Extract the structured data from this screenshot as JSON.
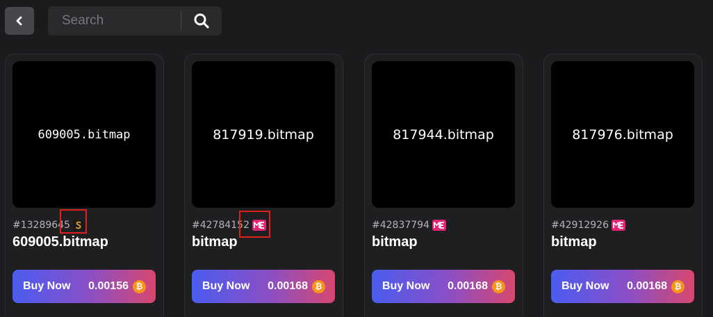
{
  "search": {
    "placeholder": "Search"
  },
  "icons": {
    "back": "chevron-left-icon",
    "search": "magnifier-icon",
    "currency": "bitcoin-icon",
    "marketplaces": [
      "s-marketplace-icon",
      "me-marketplace-icon"
    ]
  },
  "colors": {
    "background": "#1b1b1d",
    "buy_gradient": [
      "#4a5cf0",
      "#d8476f"
    ],
    "bitcoin": "#f7931a",
    "me_badge": "#e42575",
    "highlight": "#e0201c"
  },
  "cards": [
    {
      "art_label": "609005.bitmap",
      "inscription": "#13289645",
      "marketplace": "s-marketplace-icon",
      "highlighted": true,
      "title": "609005.bitmap",
      "buy_label": "Buy Now",
      "price": "0.00156"
    },
    {
      "art_label": "817919.bitmap",
      "inscription": "#42784152",
      "marketplace": "me-marketplace-icon",
      "highlighted": true,
      "title": "bitmap",
      "buy_label": "Buy Now",
      "price": "0.00168"
    },
    {
      "art_label": "817944.bitmap",
      "inscription": "#42837794",
      "marketplace": "me-marketplace-icon",
      "highlighted": false,
      "title": "bitmap",
      "buy_label": "Buy Now",
      "price": "0.00168"
    },
    {
      "art_label": "817976.bitmap",
      "inscription": "#42912926",
      "marketplace": "me-marketplace-icon",
      "highlighted": false,
      "title": "bitmap",
      "buy_label": "Buy Now",
      "price": "0.00168"
    }
  ]
}
